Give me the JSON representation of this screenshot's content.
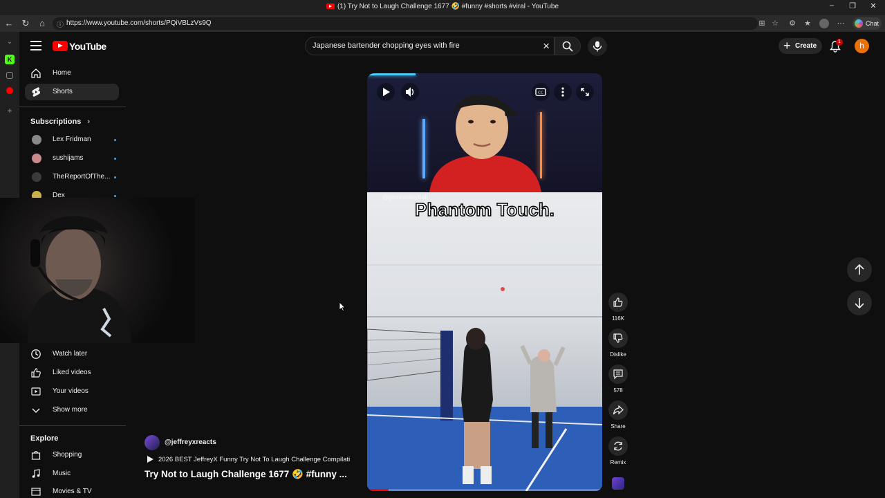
{
  "window": {
    "title": "(1) Try Not to Laugh Challenge 1677 🤣 #funny #shorts #viral - YouTube",
    "minimize": "–",
    "restore": "❐",
    "close": "✕"
  },
  "browser": {
    "url": "https://www.youtube.com/shorts/PQiVBLzVs9Q",
    "chat_label": "Chat",
    "nav_icons": [
      "back-icon",
      "refresh-icon",
      "home-icon"
    ]
  },
  "edge_rail": {
    "items": [
      "chevron-down-icon",
      "kick-app-icon",
      "calendar-icon",
      "youtube-app-icon",
      "add-icon"
    ]
  },
  "topbar": {
    "logo_text": "YouTube",
    "search": {
      "value": "Japanese bartender chopping eyes with fire",
      "placeholder": "Search"
    },
    "create_label": "Create",
    "notification_count": "1",
    "avatar_letter": "h"
  },
  "sidebar": {
    "primary": [
      {
        "label": "Home",
        "icon": "home-icon"
      },
      {
        "label": "Shorts",
        "icon": "shorts-icon",
        "active": true
      }
    ],
    "subscriptions_heading": "Subscriptions",
    "subscriptions": [
      {
        "label": "Lex Fridman"
      },
      {
        "label": "sushijams"
      },
      {
        "label": "TheReportOfThe..."
      },
      {
        "label": "Dex"
      }
    ],
    "you_items": [
      {
        "label": "Watch later",
        "icon": "clock-icon"
      },
      {
        "label": "Liked videos",
        "icon": "thumbs-up-icon"
      },
      {
        "label": "Your videos",
        "icon": "video-icon"
      },
      {
        "label": "Show more",
        "icon": "chevron-down-icon"
      }
    ],
    "explore_heading": "Explore",
    "explore": [
      {
        "label": "Shopping",
        "icon": "shopping-bag-icon"
      },
      {
        "label": "Music",
        "icon": "music-note-icon"
      },
      {
        "label": "Movies & TV",
        "icon": "film-icon"
      }
    ]
  },
  "short": {
    "caption": "Phantom Touch.",
    "clip_handle": "@gimevolleyball",
    "progress": 0.09,
    "actions": {
      "like_count": "116K",
      "dislike_label": "Dislike",
      "comments_count": "578",
      "share_label": "Share",
      "remix_label": "Remix"
    },
    "channel": "@jeffreyxreacts",
    "playlist": "2026 BEST JeffreyX Funny Try Not To Laugh Challenge Compilati...",
    "title": "Try Not to Laugh Challenge 1677 🤣 #funny ..."
  },
  "colors": {
    "background": "#0f0f0f",
    "accent": "#ff0000",
    "chip": "#272727",
    "subscription_dot": "#3ea6ff",
    "avatar": "#e8710a"
  }
}
